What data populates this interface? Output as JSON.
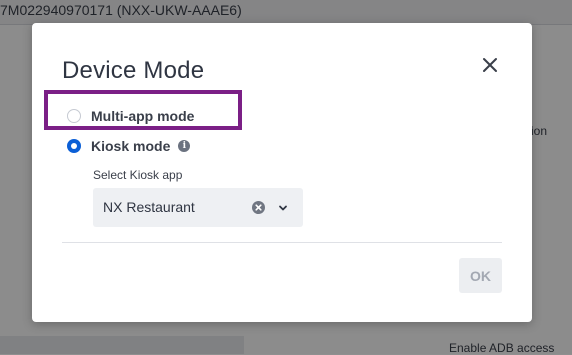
{
  "background": {
    "header_text": "7M022940970171 (NXX-UKW-AAAE6)",
    "right_text": "ion",
    "bottom_right_text": "Enable ADB access"
  },
  "modal": {
    "title": "Device Mode",
    "options": [
      {
        "label": "Multi-app mode",
        "checked": false
      },
      {
        "label": "Kiosk mode",
        "checked": true
      }
    ],
    "info_icon_glyph": "i",
    "select_label": "Select Kiosk app",
    "select_value": "NX Restaurant",
    "ok_label": "OK",
    "ok_enabled": false
  },
  "colors": {
    "highlight": "#7b1f86",
    "radio_checked": "#0b5fd6"
  }
}
